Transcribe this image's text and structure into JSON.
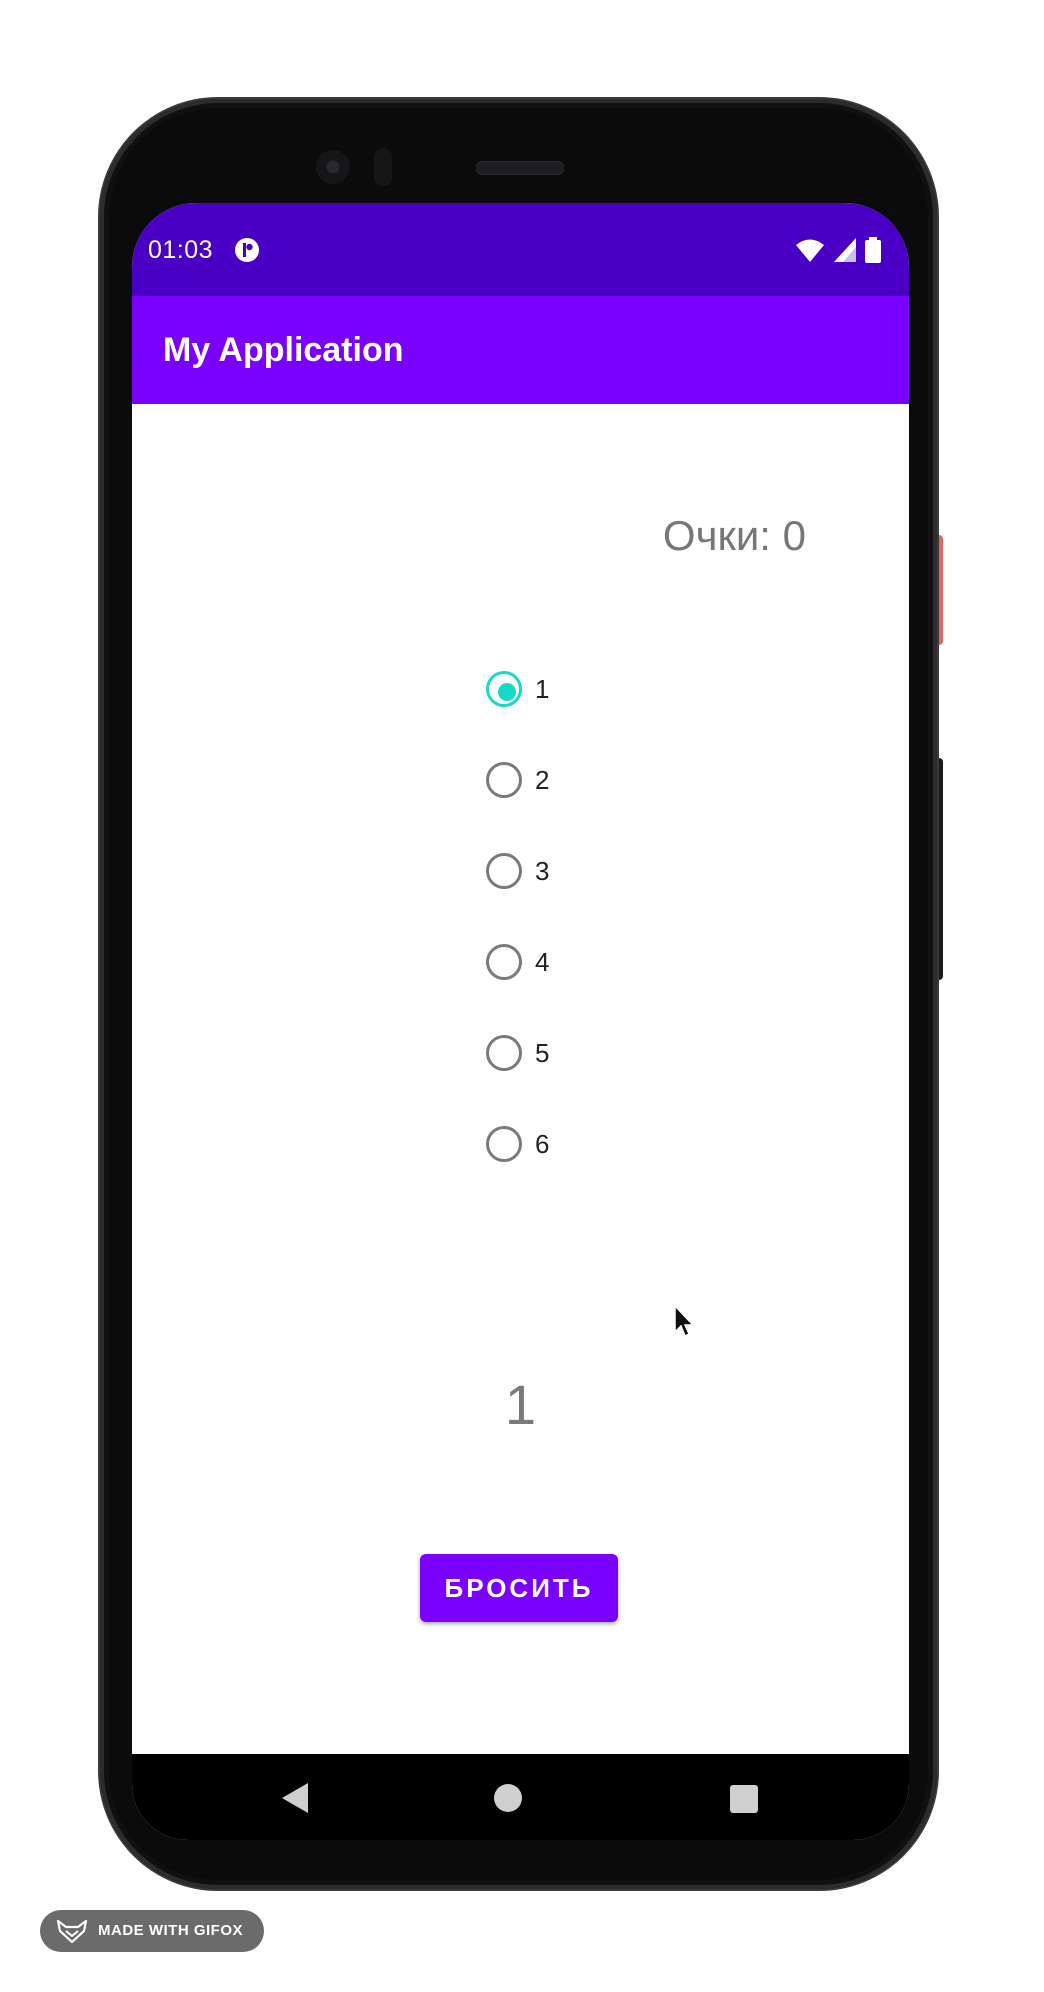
{
  "status_bar": {
    "time": "01:03"
  },
  "app_bar": {
    "title": "My Application"
  },
  "game": {
    "score_text": "Очки: 0",
    "options": [
      {
        "label": "1",
        "checked": true
      },
      {
        "label": "2",
        "checked": false
      },
      {
        "label": "3",
        "checked": false
      },
      {
        "label": "4",
        "checked": false
      },
      {
        "label": "5",
        "checked": false
      },
      {
        "label": "6",
        "checked": false
      }
    ],
    "result": "1",
    "roll_button": "БРОСИТЬ"
  },
  "watermark": {
    "text": "MADE WITH GIFOX"
  },
  "colors": {
    "status_bar": "#4a00c4",
    "app_bar": "#7a00ff",
    "accent": "#19d9c6",
    "button": "#7a00ff"
  }
}
